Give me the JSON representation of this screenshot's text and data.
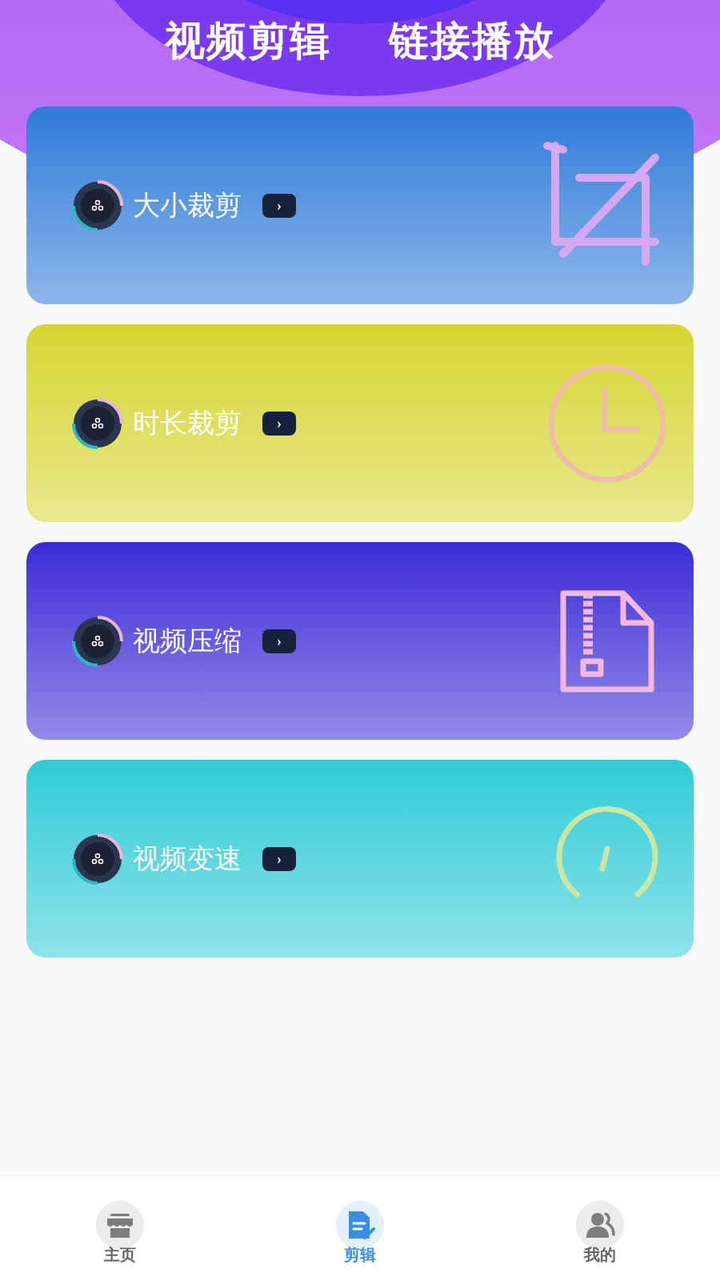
{
  "header": {
    "titles": [
      "视频剪辑",
      "链接播放"
    ]
  },
  "cards": [
    {
      "label": "大小裁剪",
      "color": "#2f7bd8",
      "arrow": "›"
    },
    {
      "label": "时长裁剪",
      "color": "#d5d630",
      "arrow": "›"
    },
    {
      "label": "视频压缩",
      "color": "#3a2cd6",
      "arrow": "›"
    },
    {
      "label": "视频变速",
      "color": "#30ccd6",
      "arrow": "›"
    }
  ],
  "bottom_nav": [
    {
      "label": "主页",
      "selected": false
    },
    {
      "label": "剪辑",
      "selected": true
    },
    {
      "label": "我的",
      "selected": false
    }
  ]
}
